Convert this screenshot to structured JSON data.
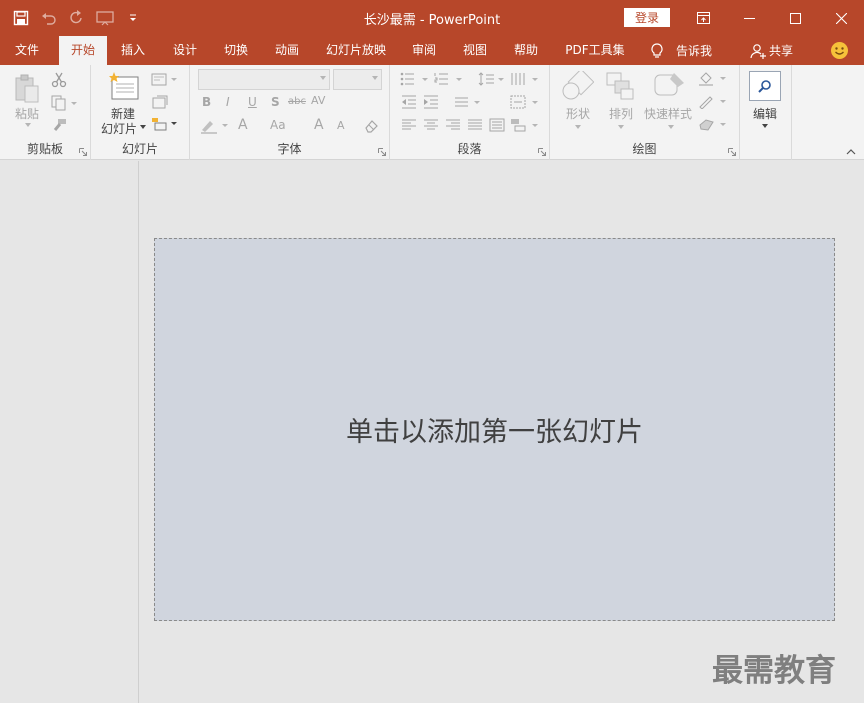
{
  "window": {
    "title": "长沙最需  -  PowerPoint",
    "login_label": "登录"
  },
  "tabs": [
    {
      "label": "文件",
      "active": false
    },
    {
      "label": "开始",
      "active": true
    },
    {
      "label": "插入",
      "active": false
    },
    {
      "label": "设计",
      "active": false
    },
    {
      "label": "切换",
      "active": false
    },
    {
      "label": "动画",
      "active": false
    },
    {
      "label": "幻灯片放映",
      "active": false
    },
    {
      "label": "审阅",
      "active": false
    },
    {
      "label": "视图",
      "active": false
    },
    {
      "label": "帮助",
      "active": false
    },
    {
      "label": "PDF工具集",
      "active": false
    }
  ],
  "tell_me": "告诉我",
  "share": "共享",
  "ribbon": {
    "clipboard": {
      "label": "剪贴板",
      "paste": "粘贴"
    },
    "slides": {
      "label": "幻灯片",
      "new_slide_line1": "新建",
      "new_slide_line2": "幻灯片"
    },
    "font": {
      "label": "字体",
      "bold": "B",
      "italic": "I",
      "underline": "U",
      "shadow": "S",
      "strike": "abc",
      "spacing": "AV",
      "font_color": "A",
      "case": "Aa",
      "grow": "A",
      "shrink": "A"
    },
    "paragraph": {
      "label": "段落"
    },
    "drawing": {
      "label": "绘图",
      "shapes": "形状",
      "arrange": "排列",
      "quick_styles": "快速样式"
    },
    "editing": {
      "label": "编辑"
    }
  },
  "slide": {
    "placeholder": "单击以添加第一张幻灯片"
  },
  "watermark": "最需教育",
  "colors": {
    "accent": "#b7472a",
    "ribbon_bg": "#f3f3f3",
    "workspace_bg": "#e6e6e6",
    "slide_bg": "#d0d5de"
  }
}
